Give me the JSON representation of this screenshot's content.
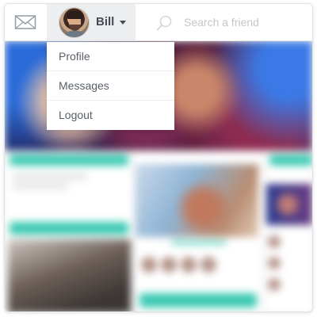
{
  "navbar": {
    "mail_icon": "envelope-icon",
    "user": {
      "name": "Bill",
      "avatar_icon": "avatar-photo",
      "caret_icon": "caret-down-icon"
    },
    "search": {
      "icon": "search-icon",
      "placeholder": "Search a friend",
      "value": ""
    }
  },
  "user_menu": {
    "items": [
      {
        "label": "Profile"
      },
      {
        "label": "Messages"
      },
      {
        "label": "Logout"
      }
    ]
  },
  "colors": {
    "accent": "#3bc9b3",
    "topbar_bg": "#ffffff",
    "user_button_bg": "#eceeef",
    "text": "#444b52",
    "placeholder": "#c3c6ca"
  }
}
